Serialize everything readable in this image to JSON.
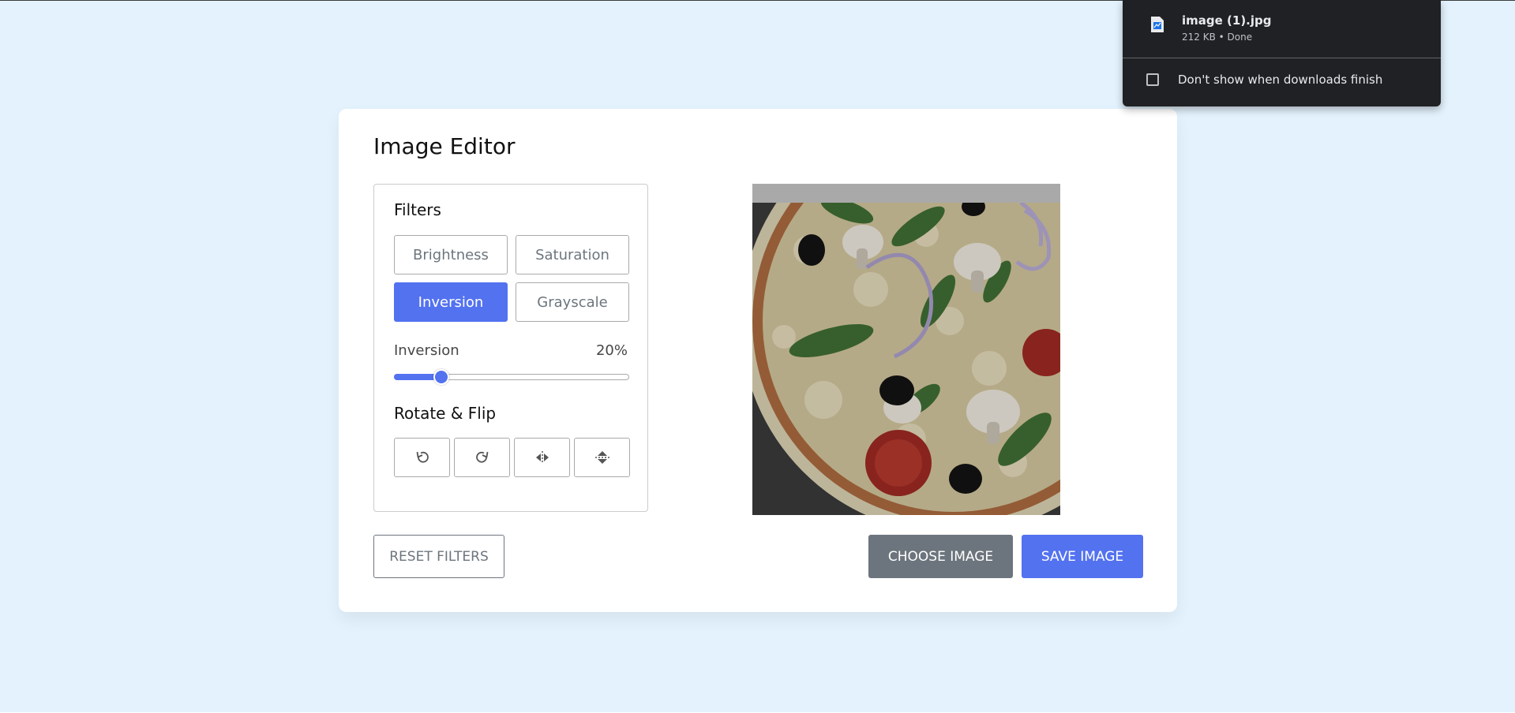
{
  "editor": {
    "title": "Image Editor",
    "filters": {
      "heading": "Filters",
      "options": [
        "Brightness",
        "Saturation",
        "Inversion",
        "Grayscale"
      ],
      "active": "Inversion",
      "slider": {
        "name": "Inversion",
        "value_text": "20%",
        "value": 0.2
      }
    },
    "rotate": {
      "heading": "Rotate & Flip",
      "buttons": [
        "rotate-left-icon",
        "rotate-right-icon",
        "flip-horizontal-icon",
        "flip-vertical-icon"
      ]
    },
    "actions": {
      "reset": "RESET FILTERS",
      "choose": "CHOOSE IMAGE",
      "save": "SAVE IMAGE"
    },
    "colors": {
      "accent": "#5372f0",
      "secondary": "#6c757d",
      "background": "#e3f2fd"
    }
  },
  "downloads": {
    "file_name": "image (1).jpg",
    "file_meta": "212 KB • Done",
    "checkbox_label": "Don't show when downloads finish",
    "checkbox_checked": false
  }
}
